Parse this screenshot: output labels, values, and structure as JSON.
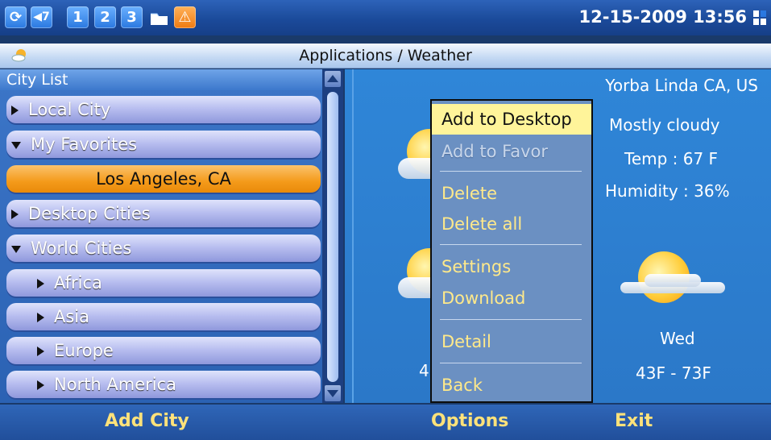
{
  "status_bar": {
    "icons": [
      {
        "name": "sync-icon",
        "text": "C"
      },
      {
        "name": "volume-icon",
        "text": "◀7"
      },
      {
        "name": "line1-icon",
        "text": "1"
      },
      {
        "name": "line2-icon",
        "text": "2"
      },
      {
        "name": "line3-icon",
        "text": "3"
      },
      {
        "name": "folder-icon",
        "text": ""
      },
      {
        "name": "warning-icon",
        "text": "⚠"
      }
    ],
    "datetime": "12-15-2009 13:56"
  },
  "title_bar": {
    "title": "Applications / Weather"
  },
  "city_list": {
    "header": "City List",
    "items": [
      {
        "label": "Local City",
        "expander": "collapsed",
        "indent": 0
      },
      {
        "label": "My Favorites",
        "expander": "expanded",
        "indent": 0
      },
      {
        "label": "Los Angeles, CA",
        "expander": "none",
        "indent": 1,
        "selected": true
      },
      {
        "label": "Desktop Cities",
        "expander": "collapsed",
        "indent": 0
      },
      {
        "label": "World Cities",
        "expander": "expanded",
        "indent": 0
      },
      {
        "label": "Africa",
        "expander": "collapsed",
        "indent": 1
      },
      {
        "label": "Asia",
        "expander": "collapsed",
        "indent": 1
      },
      {
        "label": "Europe",
        "expander": "collapsed",
        "indent": 1
      },
      {
        "label": "North America",
        "expander": "collapsed",
        "indent": 1
      }
    ]
  },
  "weather": {
    "location": "Yorba Linda CA, US",
    "condition": "Mostly cloudy",
    "temp": "Temp : 67 F",
    "humidity": "Humidity : 36%",
    "forecast_partial_left": "4",
    "forecast_day": "Wed",
    "forecast_range": "43F - 73F"
  },
  "options_menu": {
    "items": [
      {
        "label": "Add to Desktop",
        "state": "highlighted"
      },
      {
        "label": "Add to Favor",
        "state": "disabled"
      },
      {
        "label": "Delete",
        "state": "normal"
      },
      {
        "label": "Delete all",
        "state": "normal"
      },
      {
        "label": "Settings",
        "state": "normal"
      },
      {
        "label": "Download",
        "state": "normal"
      },
      {
        "label": "Detail",
        "state": "normal"
      },
      {
        "label": "Back",
        "state": "normal"
      }
    ]
  },
  "softkeys": {
    "left": "Add City",
    "middle": "Options",
    "right": "Exit"
  }
}
